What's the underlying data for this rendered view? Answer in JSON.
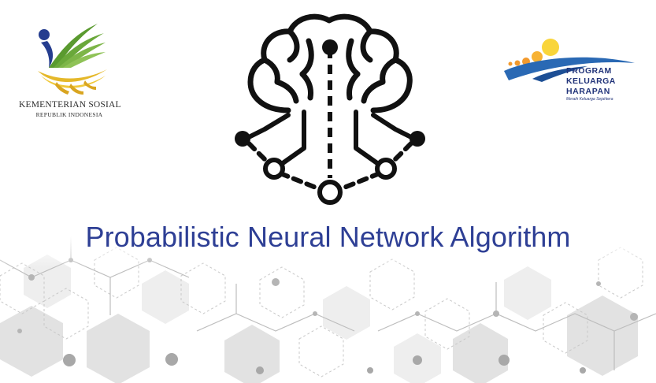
{
  "title": "Probabilistic Neural Network Algorithm",
  "left_logo": {
    "line1": "KEMENTERIAN SOSIAL",
    "line2": "REPUBLIK INDONESIA",
    "icon": "kemensos-emblem-icon"
  },
  "right_logo": {
    "line1": "PROGRAM",
    "line2": "KELUARGA",
    "line3": "HARAPAN",
    "tagline": "Meraih Keluarga Sejahtera",
    "icon": "pkh-emblem-icon"
  },
  "center_icon": "brain-network-icon",
  "background": "hexagon-network-pattern",
  "colors": {
    "title": "#2e3f95",
    "kemensos_green": "#5a9a2f",
    "kemensos_yellow": "#e5b82a",
    "kemensos_blue": "#253d8f",
    "pkh_orange": "#f39a2d",
    "pkh_yellow": "#f9d53a",
    "pkh_blue": "#2a69b4"
  }
}
